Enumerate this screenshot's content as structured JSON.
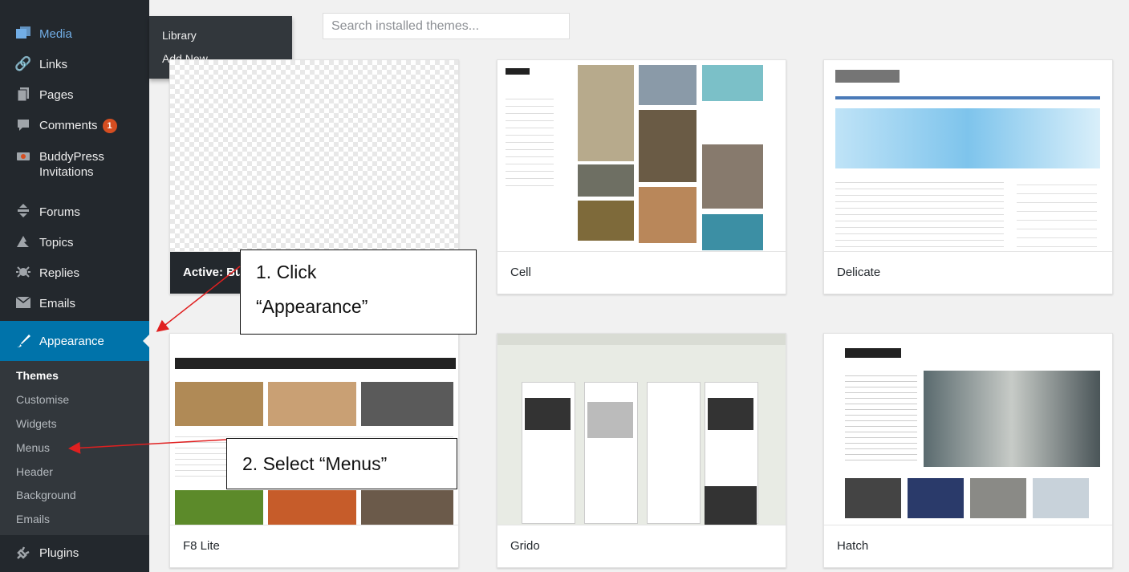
{
  "sidebar": {
    "items": [
      {
        "label": "Media",
        "icon": "media-icon"
      },
      {
        "label": "Links",
        "icon": "links-icon"
      },
      {
        "label": "Pages",
        "icon": "pages-icon"
      },
      {
        "label": "Comments",
        "icon": "comments-icon",
        "badge": "1"
      },
      {
        "label": "BuddyPress",
        "label2": "Invitations",
        "icon": "buddypress-icon"
      },
      {
        "label": "Forums",
        "icon": "forums-icon"
      },
      {
        "label": "Topics",
        "icon": "topics-icon"
      },
      {
        "label": "Replies",
        "icon": "replies-icon"
      },
      {
        "label": "Emails",
        "icon": "emails-icon"
      },
      {
        "label": "Appearance",
        "icon": "appearance-brush-icon"
      },
      {
        "label": "Plugins",
        "icon": "plugins-icon"
      }
    ],
    "appearance_submenu": [
      "Themes",
      "Customise",
      "Widgets",
      "Menus",
      "Header",
      "Background",
      "Emails"
    ],
    "media_flyout": [
      "Library",
      "Add New"
    ]
  },
  "search": {
    "placeholder": "Search installed themes..."
  },
  "themes": {
    "active_label": "Active: Bu",
    "cards": [
      "Cell",
      "Delicate",
      "F8 Lite",
      "Grido",
      "Hatch"
    ]
  },
  "callouts": {
    "step1_line1": "1. Click",
    "step1_line2": "“Appearance”",
    "step2": "2. Select “Menus”"
  },
  "colors": {
    "sidebar_bg": "#23282d",
    "highlight": "#0073aa",
    "badge": "#d54e21",
    "arrow": "#e02020"
  }
}
